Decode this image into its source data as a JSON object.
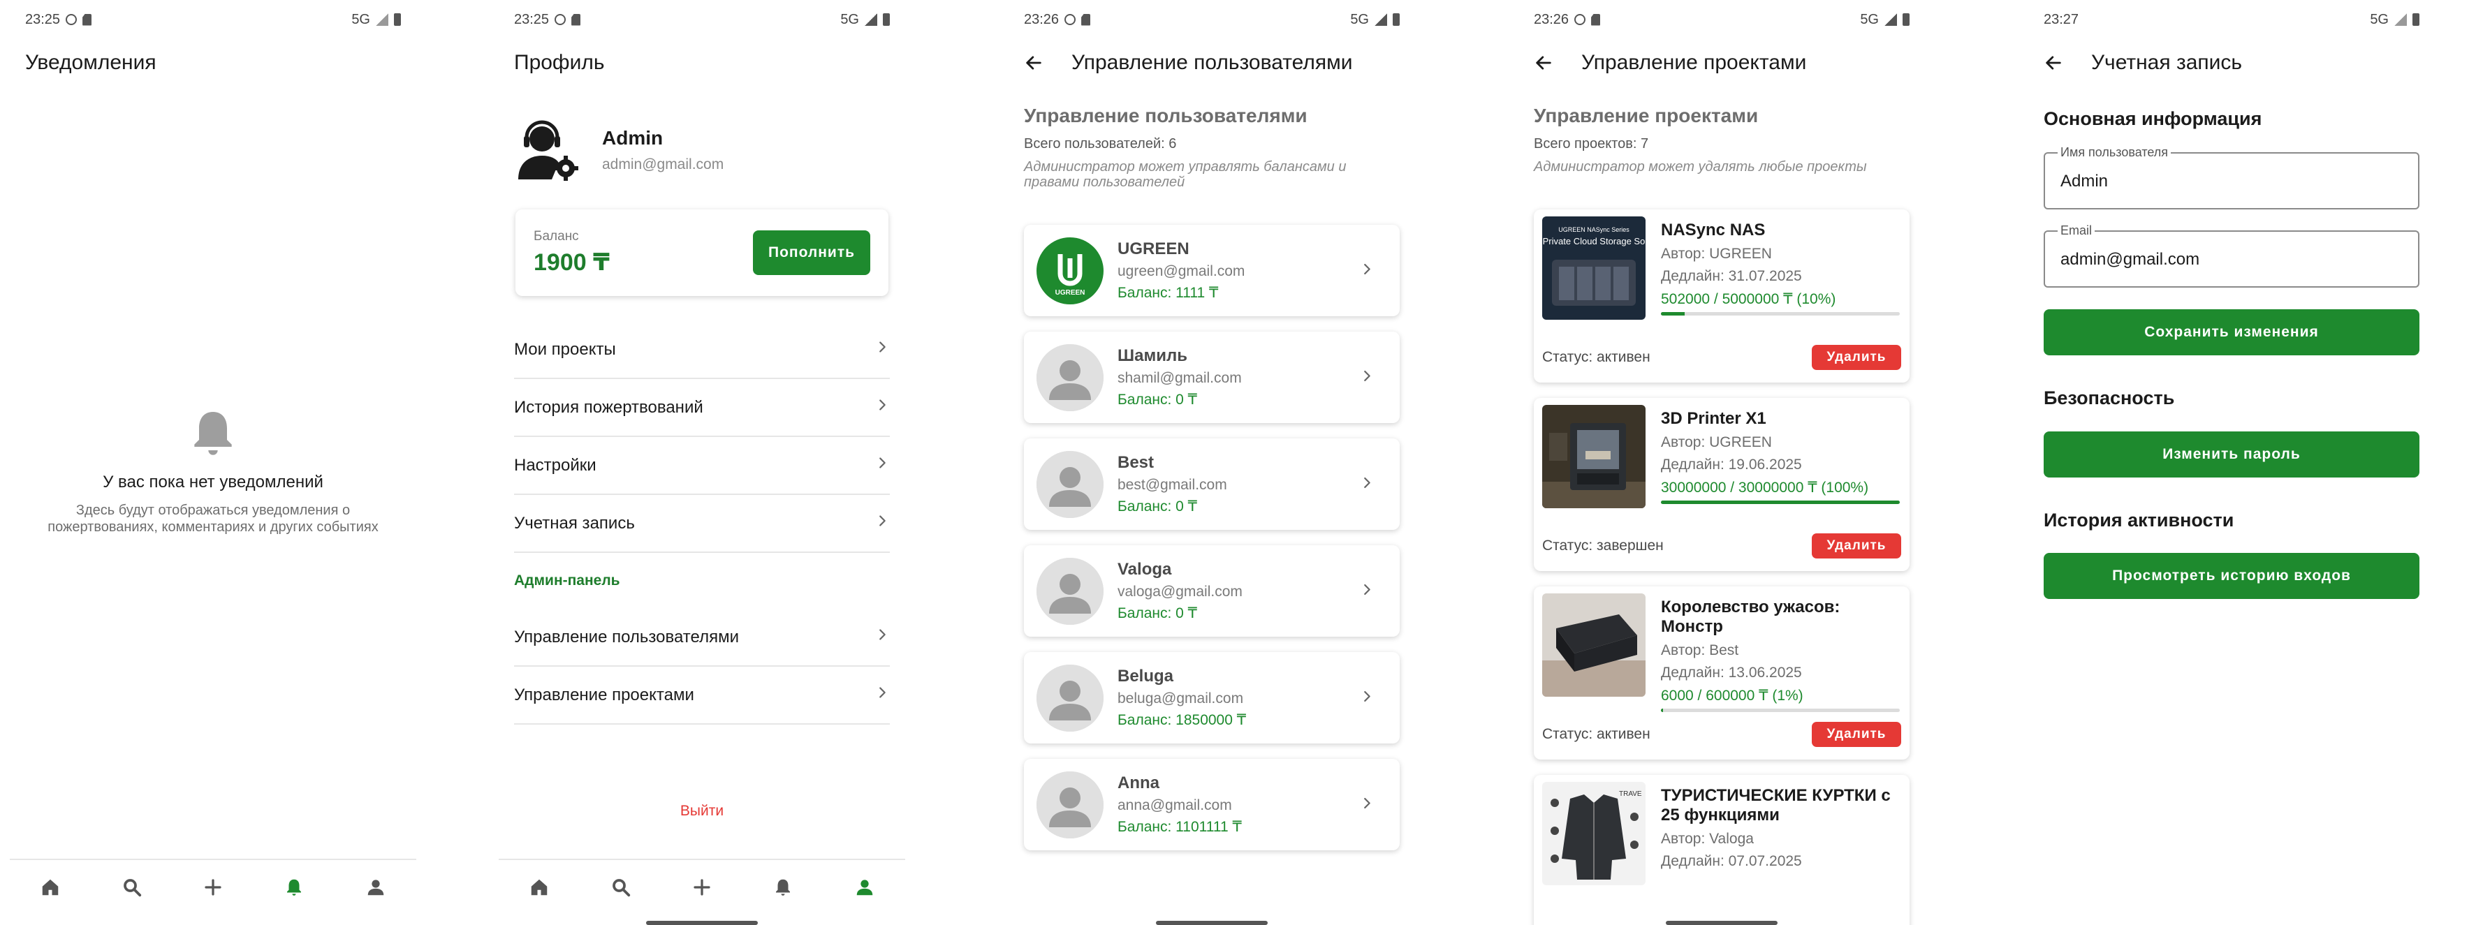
{
  "colors": {
    "primary": "#1e8a2e",
    "danger": "#e53935",
    "text": "#1b1b1b",
    "muted": "#7a7a7a"
  },
  "status_bars": [
    {
      "time": "23:25",
      "network": "5G"
    },
    {
      "time": "23:25",
      "network": "5G"
    },
    {
      "time": "23:26",
      "network": "5G"
    },
    {
      "time": "23:26",
      "network": "5G"
    },
    {
      "time": "23:27",
      "network": "5G"
    }
  ],
  "notifications": {
    "title": "Уведомления",
    "empty_title": "У вас пока нет уведомлений",
    "empty_text": "Здесь будут отображаться уведомления о пожертвованиях, комментариях и других событиях"
  },
  "profile": {
    "title": "Профиль",
    "name": "Admin",
    "email": "admin@gmail.com",
    "balance_label": "Баланс",
    "balance_value": "1900 ₸",
    "topup_label": "Пополнить",
    "menu": [
      {
        "label": "Мои проекты"
      },
      {
        "label": "История пожертвований"
      },
      {
        "label": "Настройки"
      },
      {
        "label": "Учетная запись"
      }
    ],
    "admin_section": "Админ-панель",
    "admin_menu": [
      {
        "label": "Управление пользователями"
      },
      {
        "label": "Управление проектами"
      }
    ],
    "logout": "Выйти"
  },
  "users_screen": {
    "appbar_title": "Управление пользователями",
    "heading": "Управление пользователями",
    "count": "Всего пользователей: 6",
    "note": "Администратор может управлять балансами и правами пользователей",
    "users": [
      {
        "name": "UGREEN",
        "email": "ugreen@gmail.com",
        "balance": "Баланс: 1111 ₸",
        "avatar": "ugreen-logo",
        "logo_text": "UGREEN"
      },
      {
        "name": "Шамиль",
        "email": "shamil@gmail.com",
        "balance": "Баланс: 0 ₸",
        "avatar": "person-icon"
      },
      {
        "name": "Best",
        "email": "best@gmail.com",
        "balance": "Баланс: 0 ₸",
        "avatar": "person-icon"
      },
      {
        "name": "Valoga",
        "email": "valoga@gmail.com",
        "balance": "Баланс: 0 ₸",
        "avatar": "person-icon"
      },
      {
        "name": "Beluga",
        "email": "beluga@gmail.com",
        "balance": "Баланс: 1850000 ₸",
        "avatar": "person-icon"
      },
      {
        "name": "Anna",
        "email": "anna@gmail.com",
        "balance": "Баланс: 1101111 ₸",
        "avatar": "person-icon"
      }
    ]
  },
  "projects_screen": {
    "appbar_title": "Управление проектами",
    "heading": "Управление проектами",
    "count": "Всего проектов: 7",
    "note": "Администратор может удалять любые проекты",
    "delete_label": "Удалить",
    "projects": [
      {
        "title": "NASync NAS",
        "author": "Автор: UGREEN",
        "deadline": "Дедлайн: 31.07.2025",
        "progress_text": "502000 / 5000000 ₸  (10%)",
        "progress": 10,
        "status": "Статус: активен",
        "image": "nas-device",
        "image_caption": "UGREEN NASync Series",
        "image_text": "Private Cloud Storage So"
      },
      {
        "title": "3D Printer X1",
        "author": "Автор: UGREEN",
        "deadline": "Дедлайн: 19.06.2025",
        "progress_text": "30000000 / 30000000 ₸  (100%)",
        "progress": 100,
        "status": "Статус: завершен",
        "image": "3d-printer"
      },
      {
        "title": "Королевство ужасов: Монстр",
        "author": "Автор: Best",
        "deadline": "Дедлайн: 13.06.2025",
        "progress_text": "6000 / 600000 ₸  (1%)",
        "progress": 1,
        "status": "Статус: активен",
        "image": "board-game-box"
      },
      {
        "title": "ТУРИСТИЧЕСКИЕ КУРТКИ с 25 функциями",
        "author": "Автор: Valoga",
        "deadline": "Дедлайн: 07.07.2025",
        "progress_text": "",
        "progress": 0,
        "status": "",
        "image": "jacket",
        "image_text": "TRAVE"
      }
    ]
  },
  "account_screen": {
    "appbar_title": "Учетная запись",
    "basic_info": "Основная информация",
    "username_label": "Имя пользователя",
    "username_value": "Admin",
    "email_label": "Email",
    "email_value": "admin@gmail.com",
    "save_label": "Сохранить изменения",
    "security": "Безопасность",
    "change_password": "Изменить пароль",
    "history": "История активности",
    "view_history": "Просмотреть историю входов"
  }
}
